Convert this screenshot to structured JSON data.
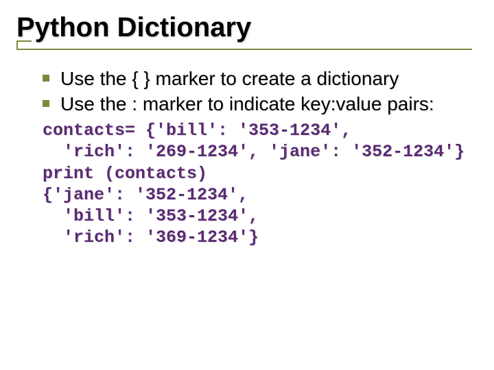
{
  "title": "Python Dictionary",
  "bullets": [
    "Use the { } marker to create a dictionary",
    "Use the : marker to indicate key:value pairs:"
  ],
  "code": {
    "l1": "contacts= {'bill': '353-1234',",
    "l2": "  'rich': '269-1234', 'jane': '352-1234'}",
    "l3": "print (contacts)",
    "l4": "{'jane': '352-1234',",
    "l5": "  'bill': '353-1234',",
    "l6": "  'rich': '369-1234'}"
  }
}
